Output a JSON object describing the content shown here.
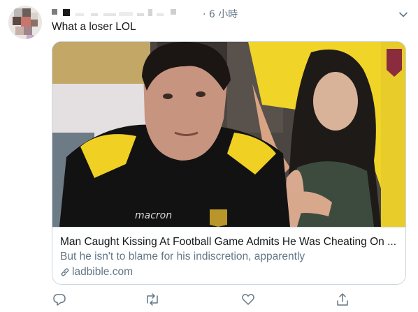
{
  "tweet": {
    "time_ago": "· 6 小時",
    "text": "What a loser LOL"
  },
  "card": {
    "title": "Man Caught Kissing At Football Game Admits He Was Cheating On ...",
    "description": "But he isn't to blame for his indiscretion, apparently",
    "domain": "ladbible.com"
  },
  "icons": {
    "menu": "chevron-down-icon",
    "link": "link-icon",
    "reply": "reply-icon",
    "retweet": "retweet-icon",
    "like": "heart-icon",
    "share": "share-icon"
  },
  "colors": {
    "secondary_text": "#657786",
    "border": "#ccd6dd",
    "jersey_yellow": "#f2d21c"
  }
}
